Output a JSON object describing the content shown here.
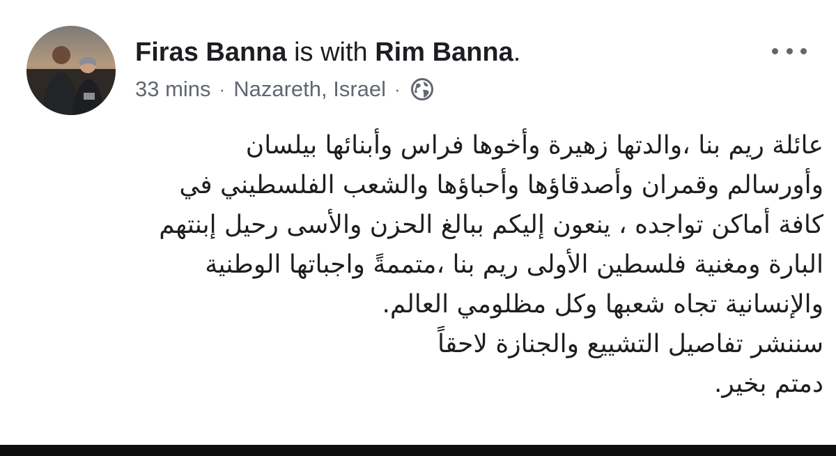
{
  "post": {
    "author": "Firas Banna",
    "with_text": "is with",
    "tagged": "Rim Banna",
    "trailing": ".",
    "time": "33 mins",
    "separator": "·",
    "location": "Nazareth, Israel",
    "privacy_icon": "globe-icon",
    "menu_icon": "more-options-icon",
    "avatar_icon": "profile-photo"
  },
  "body": {
    "lines": [
      "عائلة ريم بنا ،والدتها زهيرة وأخوها فراس وأبنائها بيلسان",
      "وأورسالم وقمران وأصدقاؤها وأحباؤها والشعب الفلسطيني في",
      "كافة أماكن تواجده ، ينعون إليكم ببالغ الحزن والأسى رحيل إبنتهم",
      "البارة ومغنية فلسطين الأولى ريم بنا ،متممةً واجباتها الوطنية",
      "والإنسانية تجاه شعبها وكل مظلومي العالم.",
      "سننشر تفاصيل التشييع والجنازة لاحقاً",
      "دمتم بخير."
    ]
  },
  "colors": {
    "text": "#1c1e21",
    "meta": "#606770",
    "background": "#ffffff",
    "bottom_bar": "#0e0e0e"
  }
}
